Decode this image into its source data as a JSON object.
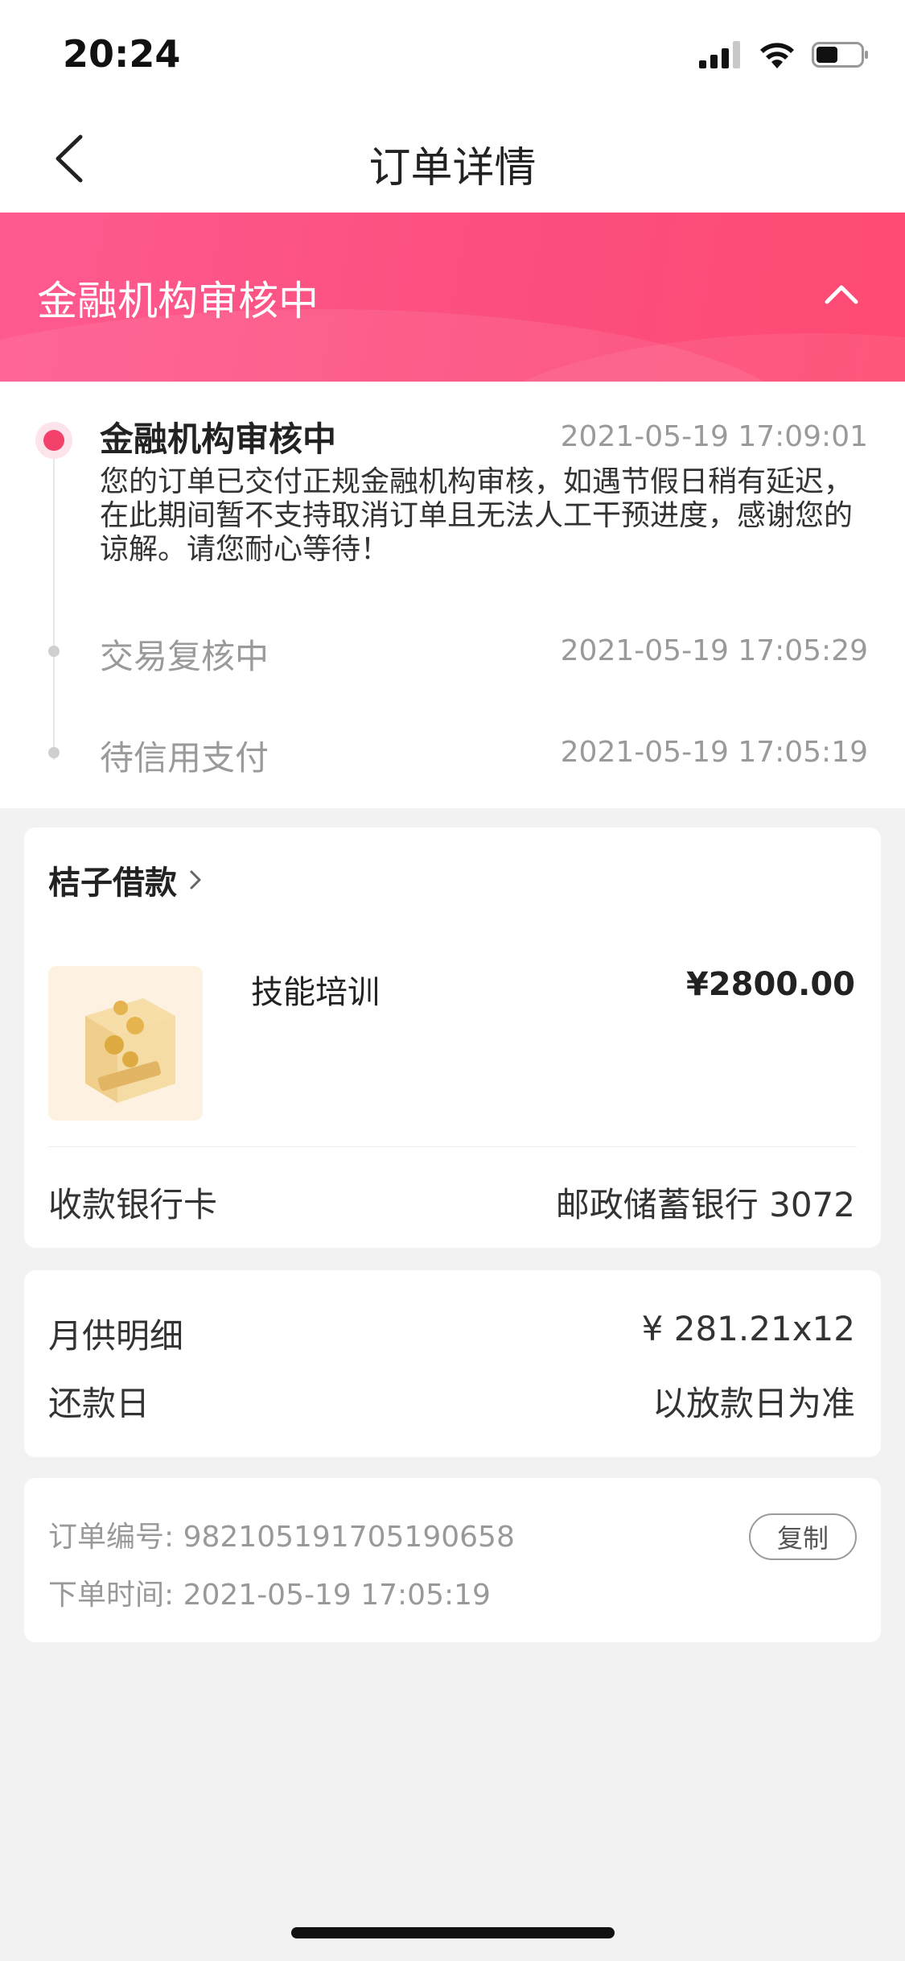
{
  "status_bar": {
    "time": "20:24"
  },
  "nav": {
    "title": "订单详情"
  },
  "banner": {
    "title": "金融机构审核中"
  },
  "timeline": [
    {
      "title": "金融机构审核中",
      "time": "2021-05-19 17:09:01",
      "desc": "您的订单已交付正规金融机构审核，如遇节假日稍有延迟，在此期间暂不支持取消订单且无法人工干预进度，感谢您的谅解。请您耐心等待！"
    },
    {
      "title": "交易复核中",
      "time": "2021-05-19 17:05:29"
    },
    {
      "title": "待信用支付",
      "time": "2021-05-19 17:05:19"
    }
  ],
  "order": {
    "merchant": "桔子借款",
    "product_name": "技能培训",
    "product_price": "¥2800.00",
    "bank_label": "收款银行卡",
    "bank_value": "邮政储蓄银行 3072"
  },
  "repayment": {
    "monthly_label": "月供明细",
    "monthly_value": "¥ 281.21x12",
    "date_label": "还款日",
    "date_value": "以放款日为准"
  },
  "order_info": {
    "order_no": "订单编号: 982105191705190658",
    "order_time": "下单时间: 2021-05-19 17:05:19",
    "copy_label": "复制"
  },
  "colors": {
    "accent": "#f4416b",
    "banner_start": "#ff5a8f",
    "banner_end": "#ff4a73"
  }
}
